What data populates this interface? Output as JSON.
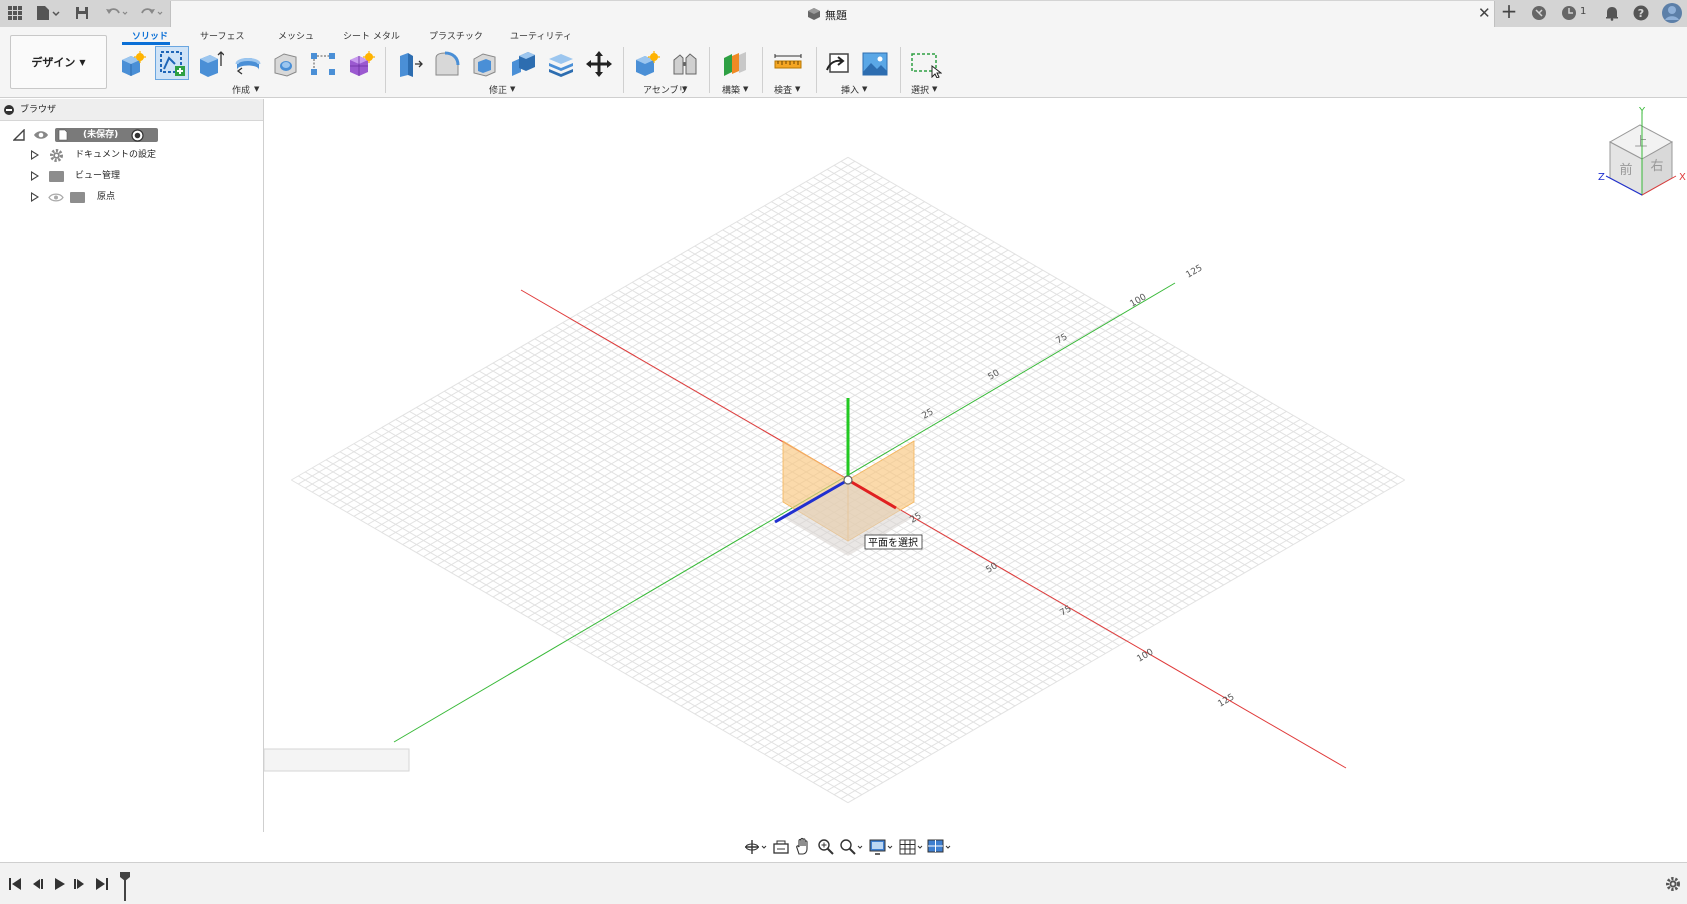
{
  "app": {
    "doc_title": "無題"
  },
  "notifications": {
    "job_count": "1"
  },
  "ribbon": {
    "workspace_label": "デザイン",
    "tabs": [
      {
        "label": "ソリッド",
        "active": true
      },
      {
        "label": "サーフェス",
        "active": false
      },
      {
        "label": "メッシュ",
        "active": false
      },
      {
        "label": "シート メタル",
        "active": false
      },
      {
        "label": "プラスチック",
        "active": false
      },
      {
        "label": "ユーティリティ",
        "active": false
      }
    ],
    "groups": {
      "create": "作成",
      "modify": "修正",
      "assemble": "アセンブリ",
      "construct": "構築",
      "inspect": "検査",
      "insert": "挿入",
      "select": "選択"
    }
  },
  "browser": {
    "title": "ブラウザ",
    "root_label": "(未保存)",
    "items": [
      {
        "label": "ドキュメントの設定",
        "icon": "gear-icon"
      },
      {
        "label": "ビュー管理",
        "icon": "folder-icon"
      },
      {
        "label": "原点",
        "icon": "folder-icon"
      }
    ]
  },
  "viewport": {
    "tooltip": "平面を選択",
    "x_axis_ticks": [
      "25",
      "50",
      "75",
      "100",
      "125"
    ],
    "z_axis_ticks": [
      "25",
      "50",
      "75",
      "100",
      "125"
    ],
    "viewcube": {
      "top": "上",
      "front": "前",
      "right": "右",
      "axis_x": "X",
      "axis_y": "Y",
      "axis_z": "Z"
    }
  },
  "colors": {
    "accent": "#0a6fd6",
    "axis_x": "#e03a3a",
    "axis_y": "#38b938",
    "axis_z": "#2030d0",
    "plane": "#f9c67e"
  }
}
